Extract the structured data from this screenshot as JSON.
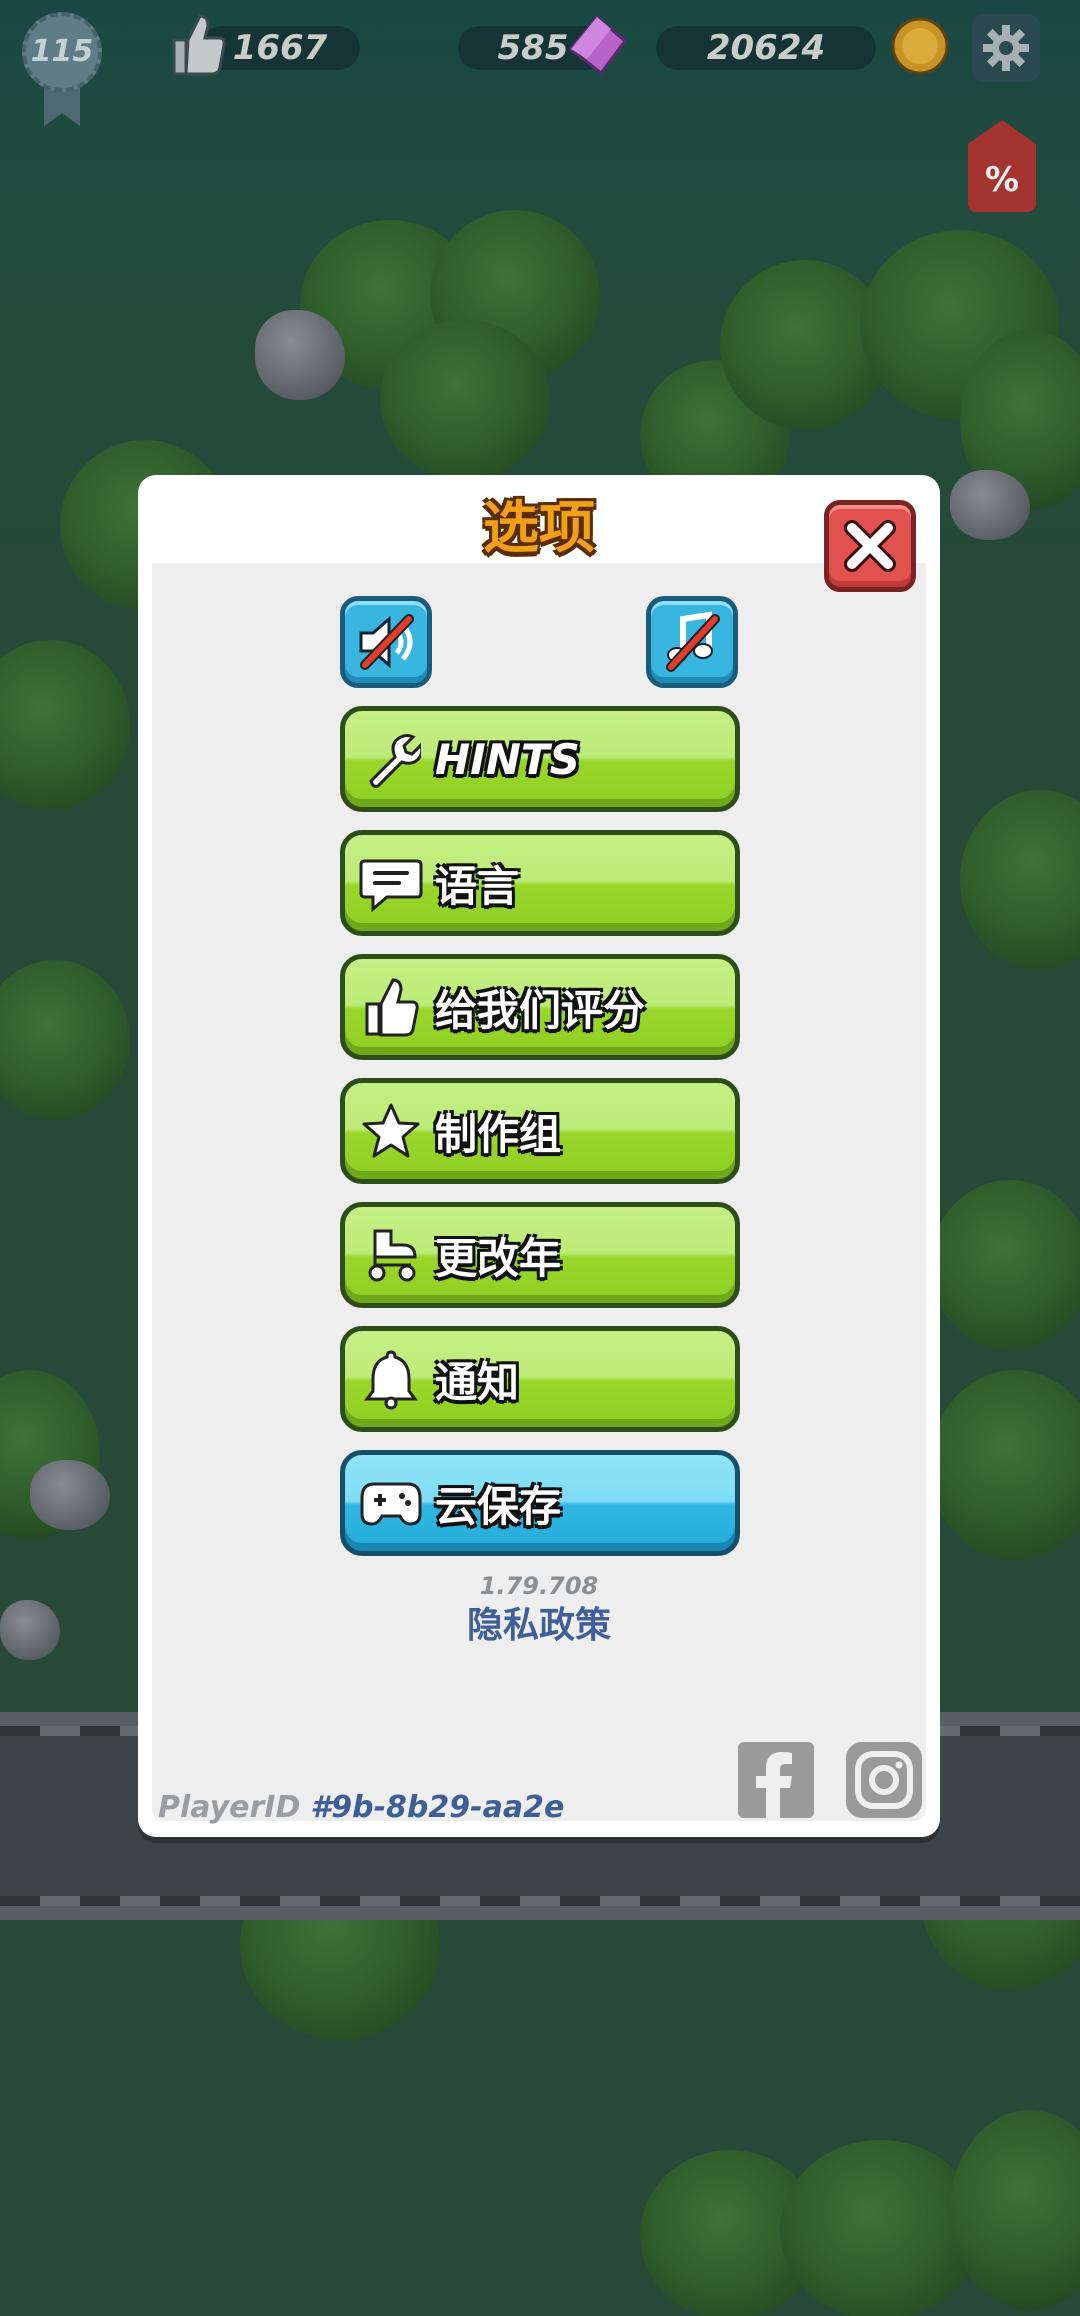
{
  "hud": {
    "level": "115",
    "likes": "1667",
    "gems": "585",
    "coins": "20624",
    "sale_tag": "%"
  },
  "modal": {
    "title": "选项",
    "toggles": [
      {
        "name": "sound-toggle",
        "icon": "speaker-muted-icon"
      },
      {
        "name": "music-toggle",
        "icon": "music-muted-icon"
      }
    ],
    "buttons": [
      {
        "label": "HINTS",
        "icon": "wrench-icon",
        "color": "green"
      },
      {
        "label": "语言",
        "icon": "chat-bubble-icon",
        "color": "green"
      },
      {
        "label": "给我们评分",
        "icon": "thumbs-up-icon",
        "color": "green"
      },
      {
        "label": "制作组",
        "icon": "star-icon",
        "color": "green"
      },
      {
        "label": "更改年",
        "icon": "stroller-icon",
        "color": "green"
      },
      {
        "label": "通知",
        "icon": "bell-icon",
        "color": "green"
      },
      {
        "label": "云保存",
        "icon": "gamepad-icon",
        "color": "blue"
      }
    ],
    "version": "1.79.708",
    "privacy": "隐私政策",
    "player_id_label": "PlayerID",
    "player_id": "#9b-8b29-aa2e"
  },
  "colors": {
    "green_button": "#8fcf22",
    "blue_button": "#2fb8e3",
    "close_button": "#e0514f",
    "title": "#f2a01a"
  }
}
